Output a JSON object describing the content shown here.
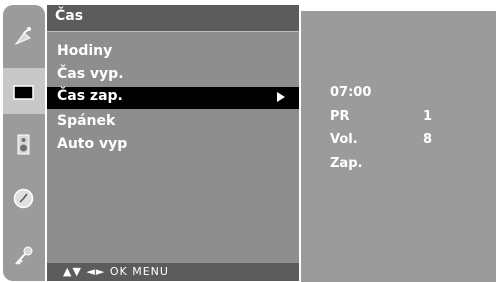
{
  "colors": {
    "strip": "#9b9b9b",
    "menu_bg": "#8e8e8e",
    "menu_title_bg": "#5c5c5c",
    "selected_bg": "#000000",
    "text": "#ffffff"
  },
  "strip": {
    "icons": [
      "satellite-dish-icon",
      "screen-icon",
      "speaker-icon",
      "clock-icon",
      "key-icon"
    ],
    "selected_index": 3
  },
  "menu": {
    "title": "Čas",
    "items": [
      {
        "label": "Hodiny"
      },
      {
        "label": "Čas vyp."
      },
      {
        "label": "Čas zap.",
        "selected": true
      },
      {
        "label": "Spánek"
      },
      {
        "label": "Auto vyp"
      }
    ],
    "footer": "▲▼ ◄► OK MENU"
  },
  "submenu": {
    "time": "07:00",
    "rows": [
      {
        "label": "PR",
        "value": "1"
      },
      {
        "label": "Vol.",
        "value": "8"
      },
      {
        "label": "Zap.",
        "value": ""
      }
    ]
  }
}
